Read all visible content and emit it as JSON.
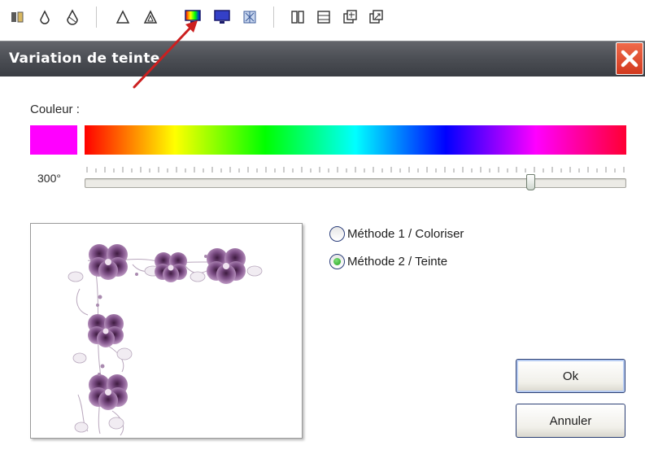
{
  "toolbar": {
    "icons": [
      "mirror-icon",
      "drop-small-icon",
      "drop-outline-icon",
      "delta-icon",
      "delta-outline-icon",
      "hue-variation-icon",
      "monitor-icon",
      "filter-icon",
      "columns-icon",
      "panel-icon",
      "layer-add-icon",
      "layer-export-icon"
    ]
  },
  "dialog": {
    "title": "Variation de teinte",
    "couleur_label": "Couleur :",
    "swatch_color": "#ff00ff",
    "angle_text": "300°",
    "hue_slider_fraction": 0.833,
    "methods": [
      {
        "label": "Méthode 1 / Coloriser",
        "selected": false
      },
      {
        "label": "Méthode 2 / Teinte",
        "selected": true
      }
    ],
    "ok_label": "Ok",
    "cancel_label": "Annuler"
  },
  "colors": {
    "titlebar": "#4d5056",
    "close": "#d9441f",
    "annotation_arrow": "#cc1f1f",
    "radio_selected": "#21a11c"
  }
}
